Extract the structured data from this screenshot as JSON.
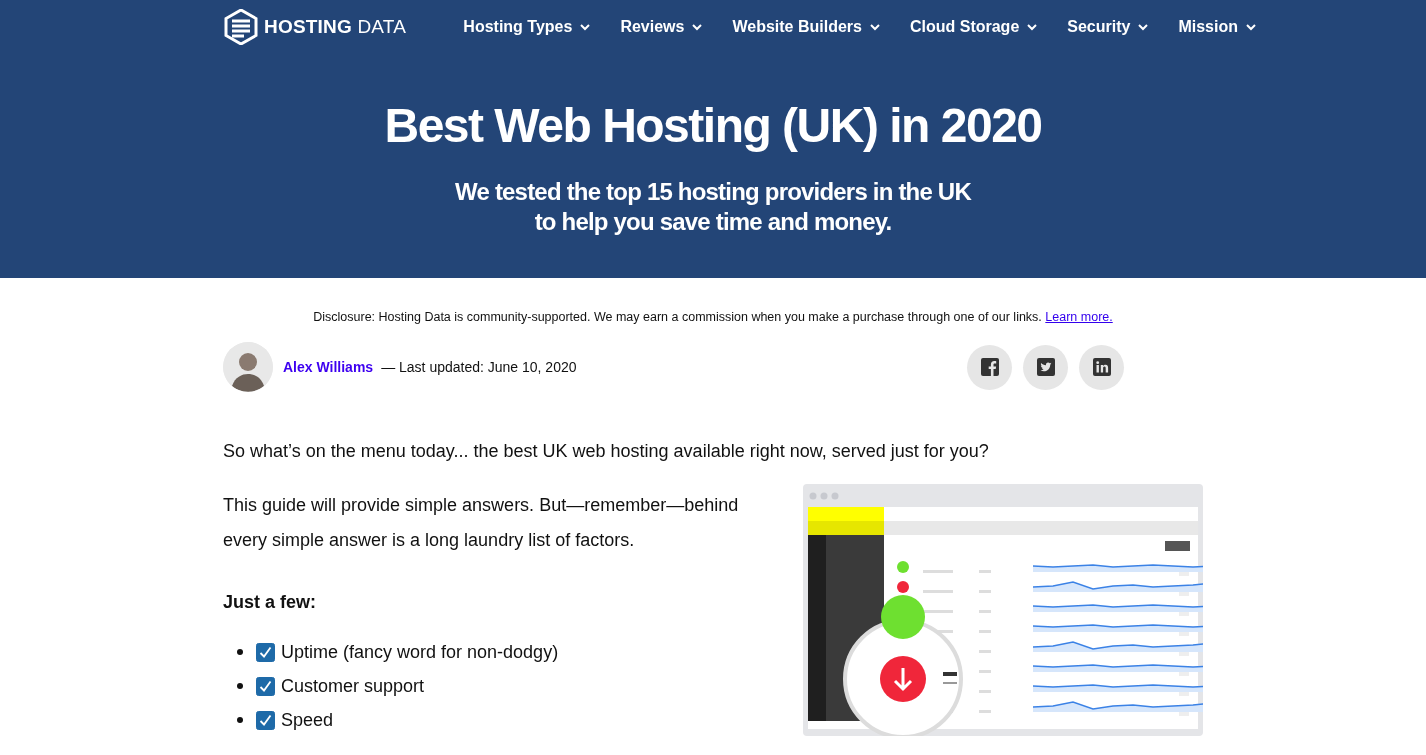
{
  "header": {
    "logo": "**HOSTING** DATA",
    "nav": [
      {
        "label": "Hosting Types"
      },
      {
        "label": "Reviews"
      },
      {
        "label": "Website Builders"
      },
      {
        "label": "Cloud Storage"
      },
      {
        "label": "Security"
      },
      {
        "label": "Mission"
      }
    ],
    "title": "Best Web Hosting (UK) in 2020",
    "subtitle_lines": [
      "We tested the top 15 hosting providers in the UK",
      "to help you save time and money."
    ]
  },
  "disclosure": {
    "text": "Disclosure: Hosting Data is community-supported. We may earn a commission when you make a purchase through one of our links.",
    "link": "Learn more."
  },
  "byline": {
    "author": "Alex Williams",
    "updated": "— Last updated: June 10, 2020",
    "share": [
      {
        "kind": "facebook"
      },
      {
        "kind": "twitter"
      },
      {
        "kind": "linkedin"
      }
    ]
  },
  "article": {
    "intro": "So what’s on the menu today... the best UK web hosting available right now, served just for you?",
    "paragraph": "This guide will provide simple answers. But—remember—behind every simple answer is a long laundry list of factors.",
    "list_heading": "Just a few:",
    "factors": [
      {
        "label": "Uptime (fancy word for non-dodgy)",
        "checked": true
      },
      {
        "label": "Customer support",
        "checked": true
      },
      {
        "label": "Speed",
        "checked": true
      }
    ]
  }
}
